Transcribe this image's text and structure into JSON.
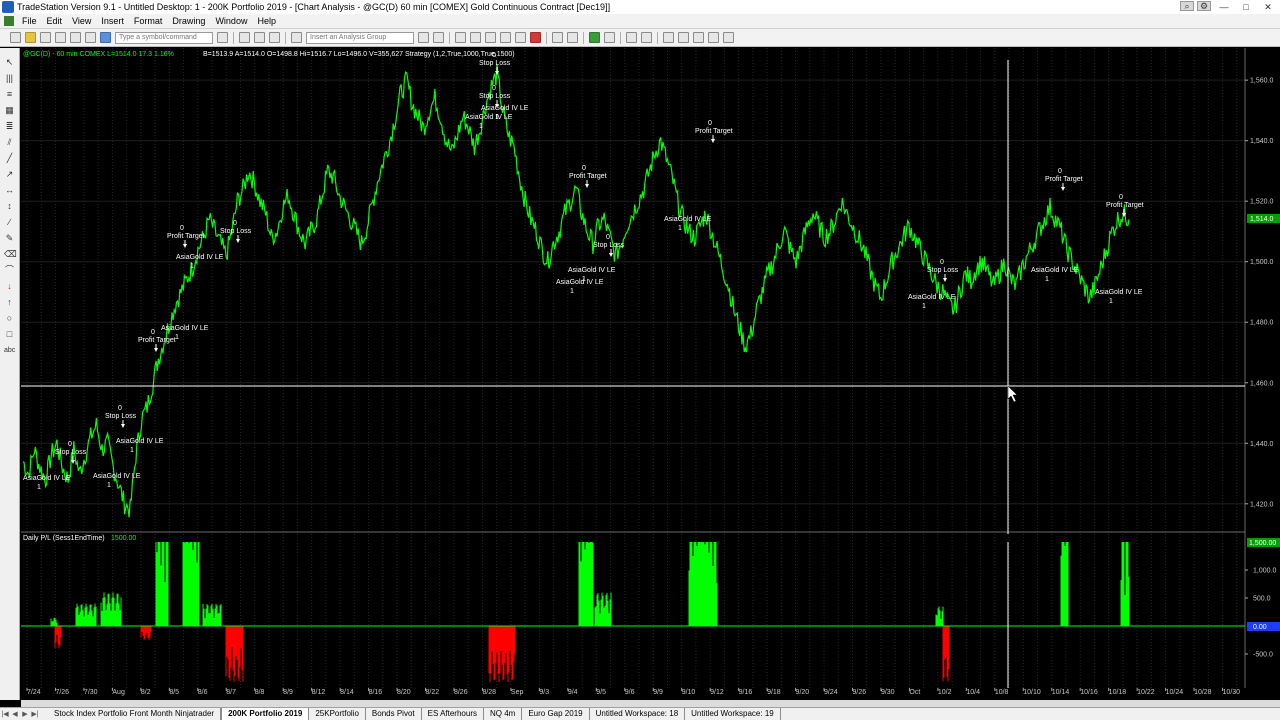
{
  "window": {
    "title": "TradeStation Version 9.1 - Untitled Desktop: 1 - 200K Portfolio 2019 - [Chart Analysis - @GC(D) 60 min [COMEX] Gold Continuous Contract [Dec19]]"
  },
  "menu": [
    "File",
    "Edit",
    "View",
    "Insert",
    "Format",
    "Drawing",
    "Window",
    "Help"
  ],
  "toolbar": {
    "symbol_placeholder": "Type a symbol/command",
    "analysis_group_placeholder": "Insert an Analysis Group"
  },
  "chart_header": {
    "symbol": "@GC(D) - 60 min  COMEX  L=1514.0  17.3  1.16%",
    "ohlc": "B=1513.9  A=1514.0  O=1498.8  Hi=1516.7  Lo=1496.0  V=355,627  Strategy (1,2,True,1000,True,1500)"
  },
  "subpanel": {
    "title": "Daily P/L (Sess1EndTime)",
    "value": "1500.00",
    "current_label": "1,500.00",
    "zero_label": "0.00"
  },
  "price_axis": [
    "1,560.0",
    "1,540.0",
    "1,520.0",
    "1,500.0",
    "1,480.0",
    "1,460.0",
    "1,440.0",
    "1,420.0"
  ],
  "current_price": "1,514.0",
  "pl_axis": [
    "1,000.0",
    "500.0",
    "-500.0"
  ],
  "date_axis": [
    "7/24",
    "7/26",
    "7/30",
    "Aug",
    "8/2",
    "8/5",
    "8/6",
    "8/7",
    "8/8",
    "8/9",
    "8/12",
    "8/14",
    "8/16",
    "8/20",
    "8/22",
    "8/26",
    "8/28",
    "Sep",
    "9/3",
    "9/4",
    "9/5",
    "9/6",
    "9/9",
    "9/10",
    "9/12",
    "9/16",
    "9/18",
    "9/20",
    "9/24",
    "9/26",
    "9/30",
    "Oct",
    "10/2",
    "10/4",
    "10/8",
    "10/10",
    "10/14",
    "10/16",
    "10/18",
    "10/22",
    "10/24",
    "10/28",
    "10/30"
  ],
  "trade_labels": {
    "stop_loss": "Stop Loss",
    "profit_target": "Profit Target",
    "entry": "AsiaGold IV LE",
    "zero": "0",
    "one": "1"
  },
  "tabs": [
    "Stock Index Portfolio Front Month Ninjatrader",
    "200K Portfolio 2019",
    "25KPortfolio",
    "Bonds Pivot",
    "ES Afterhours",
    "NQ 4m",
    "Euro Gap 2019",
    "Untitled Workspace: 18",
    "Untitled Workspace: 19"
  ],
  "active_tab_index": 1,
  "colors": {
    "price_line": "#00ff00",
    "pl_positive": "#00ff00",
    "pl_negative": "#ff0000",
    "background": "#000000",
    "current_price_tag": "#00a000",
    "grid": "#3a3a3a"
  },
  "price_series": [
    1434,
    1430,
    1438,
    1432,
    1428,
    1436,
    1440,
    1432,
    1428,
    1438,
    1430,
    1436,
    1442,
    1446,
    1438,
    1440,
    1432,
    1426,
    1420,
    1418,
    1436,
    1448,
    1452,
    1460,
    1468,
    1474,
    1480,
    1486,
    1490,
    1494,
    1498,
    1504,
    1508,
    1514,
    1510,
    1506,
    1502,
    1510,
    1520,
    1524,
    1530,
    1526,
    1520,
    1516,
    1508,
    1510,
    1518,
    1522,
    1516,
    1510,
    1506,
    1510,
    1514,
    1522,
    1530,
    1528,
    1522,
    1518,
    1514,
    1510,
    1506,
    1512,
    1520,
    1528,
    1534,
    1540,
    1548,
    1556,
    1560,
    1552,
    1548,
    1544,
    1550,
    1554,
    1548,
    1540,
    1536,
    1542,
    1548,
    1544,
    1538,
    1544,
    1552,
    1558,
    1562,
    1550,
    1542,
    1538,
    1528,
    1520,
    1514,
    1510,
    1504,
    1500,
    1506,
    1510,
    1516,
    1520,
    1524,
    1516,
    1510,
    1506,
    1512,
    1514,
    1508,
    1502,
    1506,
    1512,
    1516,
    1520,
    1524,
    1530,
    1536,
    1540,
    1534,
    1528,
    1520,
    1514,
    1510,
    1508,
    1512,
    1516,
    1510,
    1504,
    1498,
    1492,
    1484,
    1478,
    1472,
    1476,
    1484,
    1490,
    1496,
    1500,
    1506,
    1510,
    1504,
    1500,
    1506,
    1512,
    1516,
    1512,
    1508,
    1510,
    1514,
    1520,
    1516,
    1512,
    1508,
    1504,
    1498,
    1492,
    1488,
    1494,
    1500,
    1504,
    1508,
    1512,
    1508,
    1504,
    1500,
    1496,
    1492,
    1490,
    1486,
    1484,
    1490,
    1496,
    1494,
    1498,
    1500,
    1496,
    1492,
    1496,
    1500,
    1494,
    1492,
    1498,
    1502,
    1506,
    1510,
    1514,
    1518,
    1514,
    1510,
    1504,
    1500,
    1496,
    1492,
    1488,
    1492,
    1498,
    1504,
    1510,
    1514,
    1516,
    1514
  ]
}
